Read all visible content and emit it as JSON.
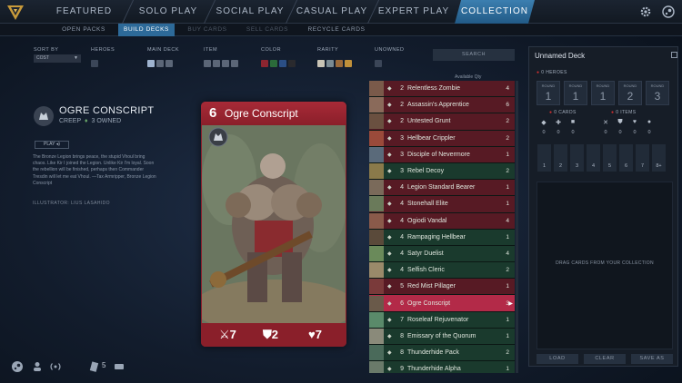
{
  "colors": {
    "accent": "#2d6a99",
    "red_card": "#8e1f2b",
    "green_row": "#1a3a2d",
    "selected_row": "#b32a48"
  },
  "nav": {
    "items": [
      {
        "label": "FEATURED",
        "active": false
      },
      {
        "label": "SOLO PLAY",
        "active": false
      },
      {
        "label": "SOCIAL PLAY",
        "active": false
      },
      {
        "label": "CASUAL PLAY",
        "active": false
      },
      {
        "label": "EXPERT PLAY",
        "active": false
      },
      {
        "label": "COLLECTION",
        "active": true
      }
    ]
  },
  "subnav": {
    "items": [
      {
        "label": "OPEN PACKS"
      },
      {
        "label": "BUILD DECKS"
      },
      {
        "label": "BUY CARDS"
      },
      {
        "label": "SELL CARDS"
      },
      {
        "label": "RECYCLE CARDS"
      }
    ]
  },
  "filters": {
    "sort_label": "SORT BY",
    "sort_value": "COST",
    "heroes_label": "HEROES",
    "main_deck_label": "MAIN DECK",
    "item_label": "ITEM",
    "color_label": "COLOR",
    "rarity_label": "RARITY",
    "unowned_label": "UNOWNED",
    "search_placeholder": "SEARCH"
  },
  "card_info": {
    "title": "OGRE CONSCRIPT",
    "type": "CREEP",
    "owned": "3 OWNED",
    "play_button": "PLAY",
    "lore": "The Bronze Legion brings peace, the stupid Vhoul bring chaos. Like Kir I joined the Legion. Unlike Kir I'm loyal. Soon the rebellion will be finished, perhaps then Commander Tresdin will let me eat Vhoul. —Tax Armripper, Bronze Legion Conscript",
    "illustrator": "ILLUSTRATOR: LIUS LASAHIDO"
  },
  "card": {
    "cost": "6",
    "name": "Ogre Conscript",
    "attack": "7",
    "armor": "2",
    "health": "7"
  },
  "list": {
    "qty_header": "Available Qty",
    "rows": [
      {
        "cost": "2",
        "name": "Relentless Zombie",
        "qty": "4",
        "color": "red"
      },
      {
        "cost": "2",
        "name": "Assassin's Apprentice",
        "qty": "6",
        "color": "red"
      },
      {
        "cost": "2",
        "name": "Untested Grunt",
        "qty": "2",
        "color": "red"
      },
      {
        "cost": "3",
        "name": "Hellbear Crippler",
        "qty": "2",
        "color": "red"
      },
      {
        "cost": "3",
        "name": "Disciple of Nevermore",
        "qty": "1",
        "color": "red"
      },
      {
        "cost": "3",
        "name": "Rebel Decoy",
        "qty": "2",
        "color": "green"
      },
      {
        "cost": "4",
        "name": "Legion Standard Bearer",
        "qty": "1",
        "color": "red"
      },
      {
        "cost": "4",
        "name": "Stonehall Elite",
        "qty": "1",
        "color": "red"
      },
      {
        "cost": "4",
        "name": "Ogiodi Vandal",
        "qty": "4",
        "color": "red"
      },
      {
        "cost": "4",
        "name": "Rampaging Hellbear",
        "qty": "1",
        "color": "green"
      },
      {
        "cost": "4",
        "name": "Satyr Duelist",
        "qty": "4",
        "color": "green"
      },
      {
        "cost": "4",
        "name": "Selfish Cleric",
        "qty": "2",
        "color": "green"
      },
      {
        "cost": "5",
        "name": "Red Mist Pillager",
        "qty": "1",
        "color": "red"
      },
      {
        "cost": "6",
        "name": "Ogre Conscript",
        "qty": "3",
        "color": "sel"
      },
      {
        "cost": "7",
        "name": "Roseleaf Rejuvenator",
        "qty": "1",
        "color": "green"
      },
      {
        "cost": "8",
        "name": "Emissary of the Quorum",
        "qty": "1",
        "color": "green"
      },
      {
        "cost": "8",
        "name": "Thunderhide Pack",
        "qty": "2",
        "color": "green"
      },
      {
        "cost": "9",
        "name": "Thunderhide Alpha",
        "qty": "1",
        "color": "green"
      }
    ]
  },
  "deck": {
    "title": "Unnamed Deck",
    "heroes_label": "0 HEROES",
    "rounds": [
      {
        "label": "ROUND",
        "num": "1"
      },
      {
        "label": "ROUND",
        "num": "1"
      },
      {
        "label": "ROUND",
        "num": "1"
      },
      {
        "label": "ROUND",
        "num": "2"
      },
      {
        "label": "ROUND",
        "num": "3"
      }
    ],
    "cards_label": "0 CARDS",
    "items_label": "0 ITEMS",
    "counts": [
      "0",
      "0",
      "0",
      "0",
      "0",
      "0",
      "0"
    ],
    "mana": [
      "1",
      "2",
      "3",
      "4",
      "5",
      "6",
      "7",
      "8+"
    ],
    "drop_text": "DRAG CARDS FROM YOUR COLLECTION",
    "load": "LOAD",
    "clear": "CLEAR",
    "save_as": "SAVE AS"
  },
  "bottombar": {
    "count": "5"
  }
}
